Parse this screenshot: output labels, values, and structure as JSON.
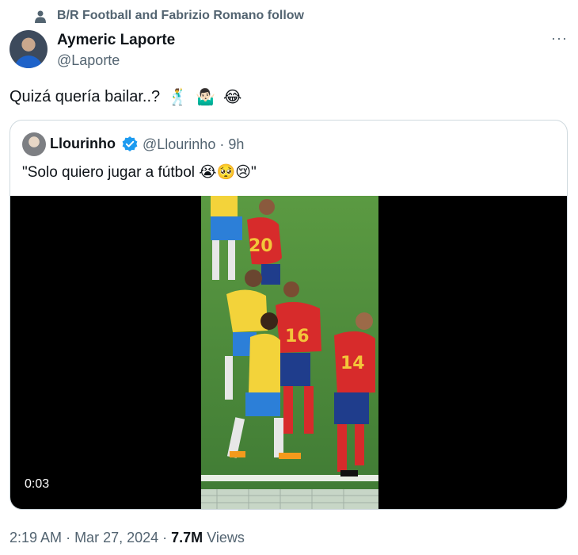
{
  "social_context": "B/R Football and Fabrizio Romano follow",
  "author": {
    "name": "Aymeric Laporte",
    "handle": "@Laporte"
  },
  "more_label": "···",
  "tweet": {
    "text": "Quizá quería bailar..?",
    "emojis": [
      "🕺",
      "🤷🏻‍♂️",
      "😂"
    ]
  },
  "quoted": {
    "name": "Llourinho",
    "handle": "@Llourinho",
    "time_separator": " · ",
    "time": "9h",
    "text": "\"Solo quiero jugar a fútbol 😭🥺😢\"",
    "video_duration": "0:03",
    "jersey_numbers": [
      "20",
      "16",
      "14"
    ]
  },
  "footer": {
    "time": "2:19 AM",
    "date": "Mar 27, 2024",
    "views_count": "7.7M",
    "views_label": "Views"
  },
  "colors": {
    "muted": "#536471",
    "verified": "#1d9bf0",
    "spain_red": "#d72b2b",
    "brazil_yellow": "#f3d33a",
    "pitch": "#4f8c3c"
  }
}
